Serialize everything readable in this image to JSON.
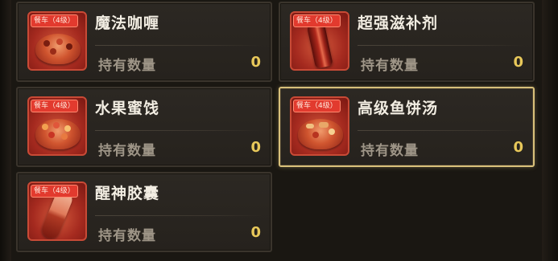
{
  "items": [
    {
      "name": "魔法咖喱",
      "badge": "餐车（4级）",
      "qty_label": "持有数量",
      "qty": "0",
      "selected": false,
      "icon": "curry-icon"
    },
    {
      "name": "超强滋补剂",
      "badge": "餐车（4级）",
      "qty_label": "持有数量",
      "qty": "0",
      "selected": false,
      "icon": "tonic-bottle-icon"
    },
    {
      "name": "水果蜜饯",
      "badge": "餐车（4级）",
      "qty_label": "持有数量",
      "qty": "0",
      "selected": false,
      "icon": "candied-fruit-icon"
    },
    {
      "name": "高级鱼饼汤",
      "badge": "餐车（4级）",
      "qty_label": "持有数量",
      "qty": "0",
      "selected": true,
      "icon": "fishcake-soup-icon"
    },
    {
      "name": "醒神胶囊",
      "badge": "餐车（4级）",
      "qty_label": "持有数量",
      "qty": "0",
      "selected": false,
      "icon": "capsule-icon"
    }
  ],
  "colors": {
    "card_bg": "#2a2621",
    "selected_border": "#d8c07a",
    "qty_value": "#e8c85a",
    "badge": "#e23a2e"
  }
}
